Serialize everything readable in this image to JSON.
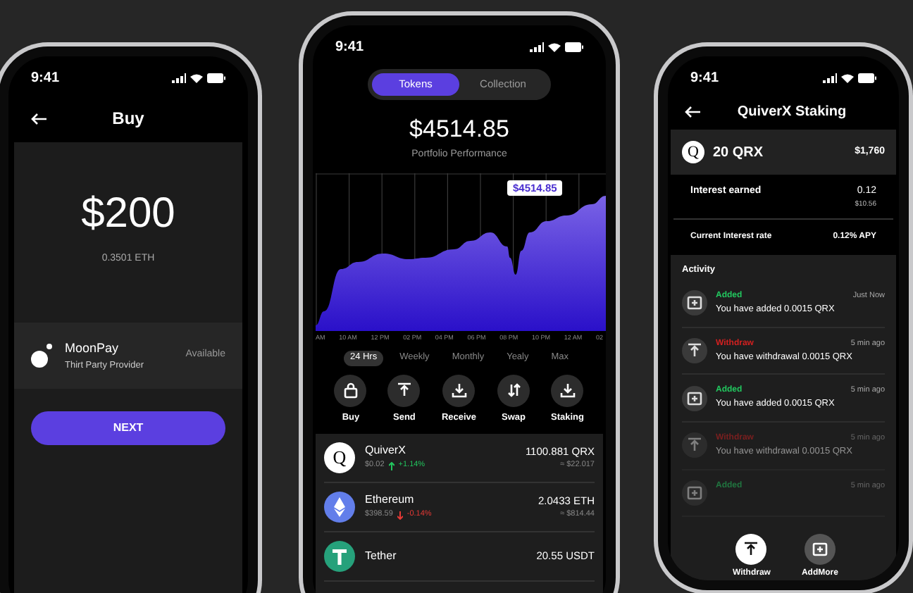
{
  "buy_screen": {
    "status_time": "9:41",
    "title": "Buy",
    "amount": "$200",
    "amount_eth": "0.3501 ETH",
    "provider": {
      "name": "MoonPay",
      "subtitle": "Thirt Party Provider",
      "status": "Available"
    },
    "next_button": "NEXT"
  },
  "portfolio_screen": {
    "status_time": "9:41",
    "tabs": [
      {
        "label": "Tokens",
        "selected": true
      },
      {
        "label": "Collection",
        "selected": false
      }
    ],
    "total": "$4514.85",
    "subtitle": "Portfolio Performance",
    "chart_tooltip": "$4514.85",
    "chart_x_labels": [
      "AM",
      "10 AM",
      "12 PM",
      "02 PM",
      "04 PM",
      "06 PM",
      "08 PM",
      "10 PM",
      "12 AM",
      "02"
    ],
    "ranges": [
      {
        "label": "24 Hrs",
        "selected": true
      },
      {
        "label": "Weekly",
        "selected": false
      },
      {
        "label": "Monthly",
        "selected": false
      },
      {
        "label": "Yealy",
        "selected": false
      },
      {
        "label": "Max",
        "selected": false
      }
    ],
    "actions": [
      {
        "label": "Buy",
        "kind": "bag"
      },
      {
        "label": "Send",
        "kind": "upload"
      },
      {
        "label": "Receive",
        "kind": "download"
      },
      {
        "label": "Swap",
        "kind": "swap"
      },
      {
        "label": "Staking",
        "kind": "download"
      }
    ],
    "tokens": [
      {
        "name": "QuiverX",
        "kind": "letter",
        "icon_text": "Q",
        "price": "$0.02",
        "rising": true,
        "change": "+1.14%",
        "amount": "1100.881 QRX",
        "value": "≈ $22.017"
      },
      {
        "name": "Ethereum",
        "kind": "diamond",
        "price": "$398.59",
        "rising": false,
        "change": "-0.14%",
        "amount": "2.0433 ETH",
        "value": "≈ $814.44"
      },
      {
        "name": "Tether",
        "kind": "tee",
        "amount": "20.55 USDT"
      }
    ]
  },
  "staking_screen": {
    "status_time": "9:41",
    "title": "QuiverX Staking",
    "coin_icon_text": "Q",
    "coin_amount": "20 QRX",
    "coin_value": "$1,760",
    "interest_label": "Interest earned",
    "interest_value": "0.12",
    "interest_usd": "$10.56",
    "rate_label": "Current Interest rate",
    "rate_value": "0.12% APY",
    "activity_title": "Activity",
    "activity": [
      {
        "kind": "added",
        "label": "Added",
        "time": "Just Now",
        "message": "You have added 0.0015 QRX",
        "faded": false
      },
      {
        "kind": "withdraw",
        "label": "Withdraw",
        "time": "5 min ago",
        "message": "You have withdrawal 0.0015 QRX",
        "faded": false
      },
      {
        "kind": "added",
        "label": "Added",
        "time": "5 min ago",
        "message": "You have added 0.0015 QRX",
        "faded": false
      },
      {
        "kind": "withdraw",
        "label": "Withdraw",
        "time": "5 min ago",
        "message": "You have withdrawal 0.0015 QRX",
        "faded": true
      },
      {
        "kind": "added",
        "label": "Added",
        "time": "5 min ago",
        "faded": true
      }
    ],
    "floating_buttons": [
      {
        "label": "Withdraw",
        "kind": "upload",
        "primary": true
      },
      {
        "label": "AddMore",
        "kind": "add",
        "primary": false
      }
    ]
  }
}
